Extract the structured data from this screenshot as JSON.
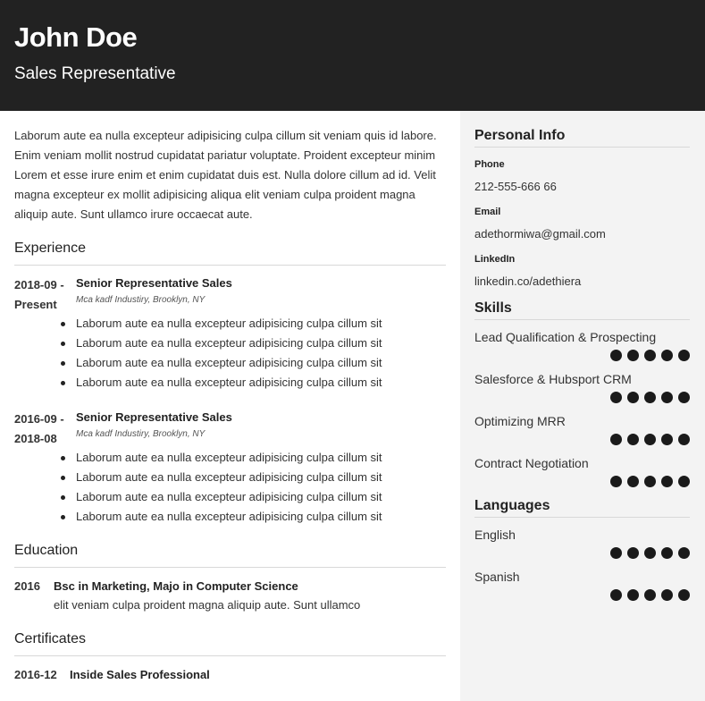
{
  "header": {
    "name": "John Doe",
    "role": "Sales Representative"
  },
  "summary": "Laborum aute ea nulla excepteur adipisicing culpa cillum sit veniam quis id labore. Enim veniam mollit nostrud cupidatat pariatur voluptate. Proident excepteur minim Lorem et esse irure enim et enim cupidatat duis est. Nulla dolore cillum ad id. Velit magna excepteur ex mollit adipisicing aliqua elit veniam culpa proident magna aliquip aute. Sunt ullamco irure occaecat aute.",
  "experience": {
    "title": "Experience",
    "jobs": [
      {
        "date_start": "2018-09 -",
        "date_end": "Present",
        "title": "Senior Representative Sales",
        "company": "Mca kadf Industiry, Brooklyn, NY",
        "bullets": [
          "Laborum aute ea nulla excepteur adipisicing culpa cillum sit",
          "Laborum aute ea nulla excepteur adipisicing culpa cillum sit",
          "Laborum aute ea nulla excepteur adipisicing culpa cillum sit",
          "Laborum aute ea nulla excepteur adipisicing culpa cillum sit"
        ]
      },
      {
        "date_start": "2016-09 -",
        "date_end": "2018-08",
        "title": "Senior Representative Sales",
        "company": "Mca kadf Industiry, Brooklyn, NY",
        "bullets": [
          "Laborum aute ea nulla excepteur adipisicing culpa cillum sit",
          "Laborum aute ea nulla excepteur adipisicing culpa cillum sit",
          "Laborum aute ea nulla excepteur adipisicing culpa cillum sit",
          "Laborum aute ea nulla excepteur adipisicing culpa cillum sit"
        ]
      }
    ]
  },
  "education": {
    "title": "Education",
    "items": [
      {
        "date": "2016",
        "title": "Bsc in Marketing, Majo in Computer Science",
        "desc": "elit veniam culpa proident magna aliquip aute. Sunt ullamco"
      }
    ]
  },
  "certificates": {
    "title": "Certificates",
    "items": [
      {
        "date": "2016-12",
        "title": "Inside Sales Professional"
      }
    ]
  },
  "personal_info": {
    "title": "Personal Info",
    "phone_label": "Phone",
    "phone": "212-555-666 66",
    "email_label": "Email",
    "email": "adethormiwa@gmail.com",
    "linkedin_label": "LinkedIn",
    "linkedin": "linkedin.co/adethiera"
  },
  "skills": {
    "title": "Skills",
    "items": [
      {
        "name": "Lead Qualification & Prospecting",
        "level": 5,
        "max": 5
      },
      {
        "name": "Salesforce & Hubsport CRM",
        "level": 5,
        "max": 5
      },
      {
        "name": "Optimizing MRR",
        "level": 5,
        "max": 5
      },
      {
        "name": "Contract Negotiation",
        "level": 5,
        "max": 5
      }
    ]
  },
  "languages": {
    "title": "Languages",
    "items": [
      {
        "name": "English",
        "level": 5,
        "max": 5
      },
      {
        "name": "Spanish",
        "level": 5,
        "max": 5
      }
    ]
  }
}
